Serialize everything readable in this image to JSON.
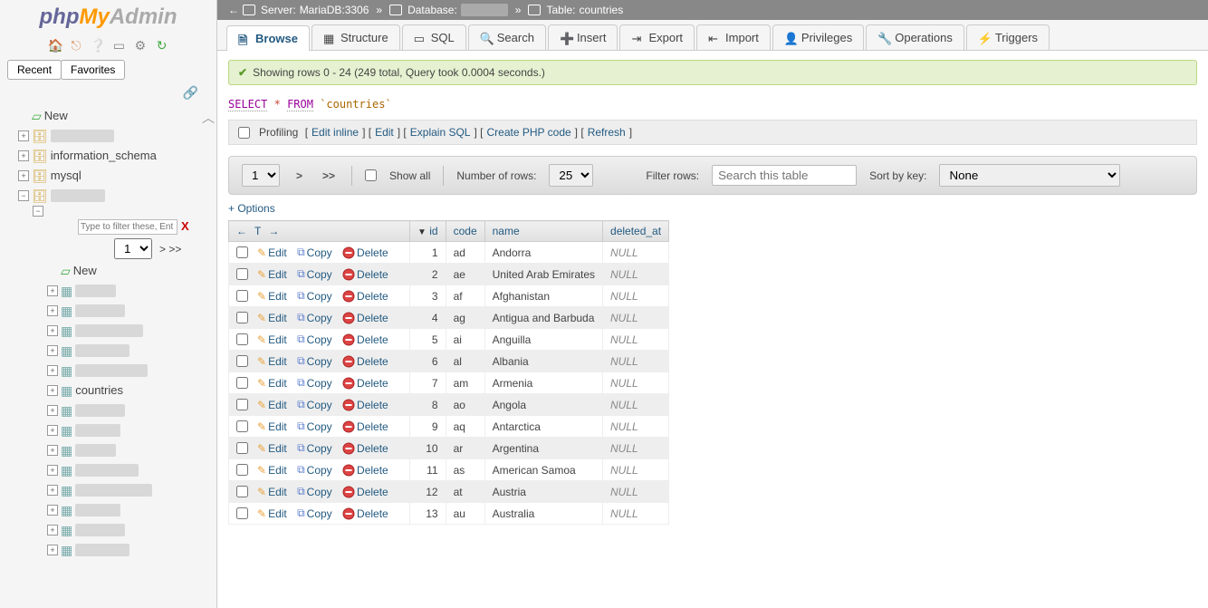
{
  "logo": {
    "php": "php",
    "my": "My",
    "admin": "Admin"
  },
  "sidebar_tabs": {
    "recent": "Recent",
    "favorites": "Favorites"
  },
  "tree": {
    "new": "New",
    "information_schema": "information_schema",
    "mysql": "mysql",
    "filter_placeholder": "Type to filter these, Ent",
    "page_option": "1",
    "page_nav": "> >>",
    "sub_new": "New",
    "countries": "countries"
  },
  "breadcrumb": {
    "server_label": "Server:",
    "server_value": "MariaDB:3306",
    "database_label": "Database:",
    "table_label": "Table:",
    "table_value": "countries"
  },
  "tabs": {
    "browse": "Browse",
    "structure": "Structure",
    "sql": "SQL",
    "search": "Search",
    "insert": "Insert",
    "export": "Export",
    "import": "Import",
    "privileges": "Privileges",
    "operations": "Operations",
    "triggers": "Triggers"
  },
  "success_msg": "Showing rows 0 - 24 (249 total, Query took 0.0004 seconds.)",
  "sql": {
    "select": "SELECT",
    "star": "*",
    "from": "FROM",
    "table": "`countries`"
  },
  "actionbar": {
    "profiling": "Profiling",
    "edit_inline": "Edit inline",
    "edit": "Edit",
    "explain": "Explain SQL",
    "create_php": "Create PHP code",
    "refresh": "Refresh"
  },
  "navbar": {
    "page": "1",
    "next": ">",
    "last": ">>",
    "show_all": "Show all",
    "rows_label": "Number of rows:",
    "rows_value": "25",
    "filter_label": "Filter rows:",
    "filter_placeholder": "Search this table",
    "sort_label": "Sort by key:",
    "sort_value": "None"
  },
  "options": "+ Options",
  "columns": {
    "id": "id",
    "code": "code",
    "name": "name",
    "deleted_at": "deleted_at"
  },
  "row_actions": {
    "edit": "Edit",
    "copy": "Copy",
    "delete": "Delete"
  },
  "null_text": "NULL",
  "rows": [
    {
      "id": "1",
      "code": "ad",
      "name": "Andorra"
    },
    {
      "id": "2",
      "code": "ae",
      "name": "United Arab Emirates"
    },
    {
      "id": "3",
      "code": "af",
      "name": "Afghanistan"
    },
    {
      "id": "4",
      "code": "ag",
      "name": "Antigua and Barbuda"
    },
    {
      "id": "5",
      "code": "ai",
      "name": "Anguilla"
    },
    {
      "id": "6",
      "code": "al",
      "name": "Albania"
    },
    {
      "id": "7",
      "code": "am",
      "name": "Armenia"
    },
    {
      "id": "8",
      "code": "ao",
      "name": "Angola"
    },
    {
      "id": "9",
      "code": "aq",
      "name": "Antarctica"
    },
    {
      "id": "10",
      "code": "ar",
      "name": "Argentina"
    },
    {
      "id": "11",
      "code": "as",
      "name": "American Samoa"
    },
    {
      "id": "12",
      "code": "at",
      "name": "Austria"
    },
    {
      "id": "13",
      "code": "au",
      "name": "Australia"
    }
  ]
}
